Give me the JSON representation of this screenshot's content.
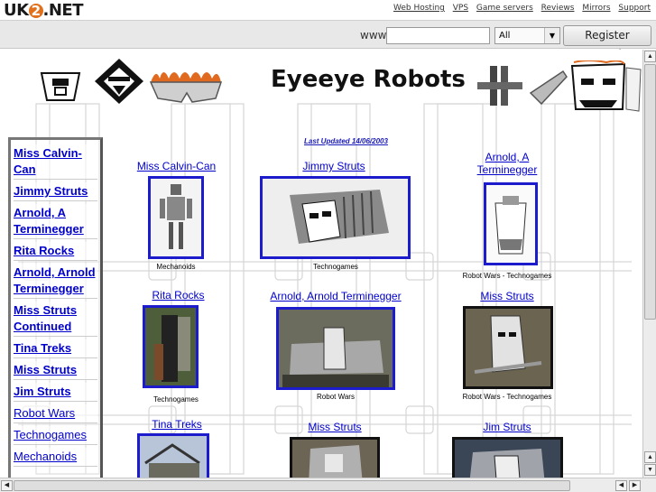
{
  "header": {
    "logo_prefix": "UK",
    "logo_circle": "2",
    "logo_suffix": ".NET",
    "links": [
      "Web Hosting",
      "VPS",
      "Game servers",
      "Reviews",
      "Mirrors",
      "Support"
    ]
  },
  "domain_bar": {
    "www_label": "www.",
    "input_value": "",
    "select_value": "All",
    "register_label": "Register Domain"
  },
  "page": {
    "title": "Eyeeye Robots",
    "last_updated": "Last Updated 14/06/2003"
  },
  "sidebar": {
    "items": [
      "Miss Calvin-Can",
      "Jimmy Struts",
      "Arnold, A Terminegger",
      "Rita Rocks",
      "Arnold, Arnold Terminegger",
      "Miss Struts Continued",
      "Tina Treks",
      "Miss Struts",
      "Jim Struts",
      "Robot Wars",
      "Technogames",
      "Mechanoids"
    ]
  },
  "gallery": [
    {
      "title": "Miss Calvin-Can",
      "subtitle": "Mechanoids"
    },
    {
      "title": "Jimmy Struts",
      "subtitle": "Technogames"
    },
    {
      "title": "Arnold, A Terminegger",
      "subtitle": "Robot Wars - Technogames"
    },
    {
      "title": "Rita Rocks",
      "subtitle": "Technogames"
    },
    {
      "title": "Arnold, Arnold Terminegger",
      "subtitle": "Robot Wars"
    },
    {
      "title": "Miss Struts",
      "subtitle": "Robot Wars - Technogames"
    },
    {
      "title": "Tina Treks",
      "subtitle": ""
    },
    {
      "title": "Miss Struts",
      "subtitle": ""
    },
    {
      "title": "Jim Struts",
      "subtitle": ""
    }
  ],
  "colors": {
    "link": "#0000cc",
    "frame_border": "#1c1ccc",
    "logo_accent": "#e0701c",
    "toolbar_bg": "#e8e8e8"
  },
  "icons": [
    "dropdown-arrow-icon",
    "scroll-up-icon",
    "scroll-down-icon",
    "scroll-left-icon",
    "scroll-right-icon"
  ]
}
